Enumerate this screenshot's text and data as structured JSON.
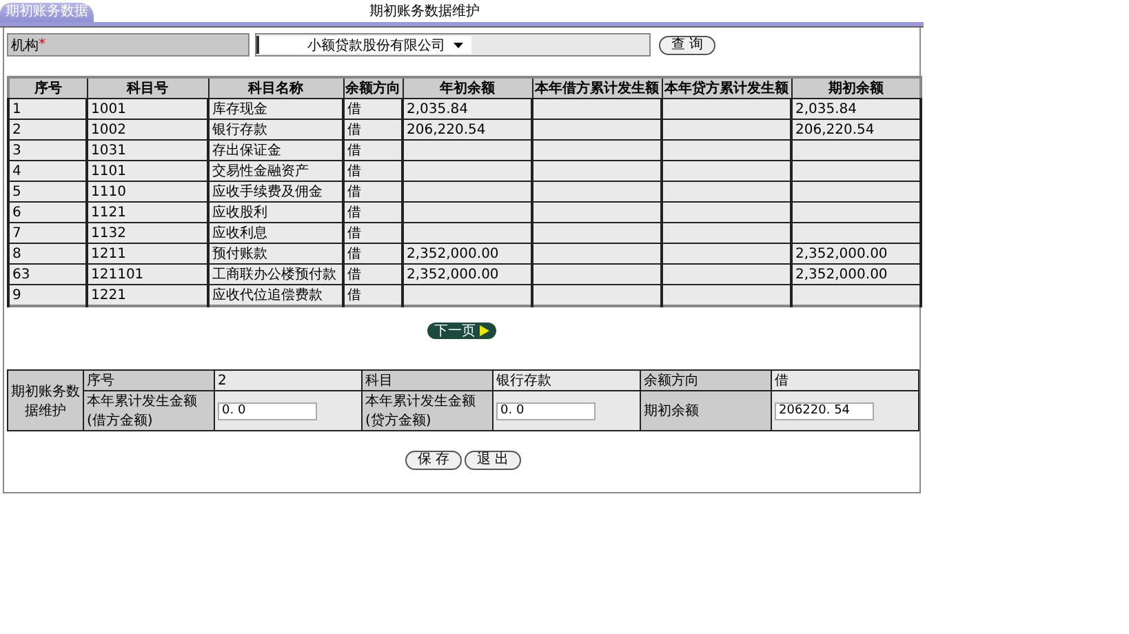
{
  "tab": {
    "label": "期初账务数据",
    "selected": true
  },
  "title": "期初账务数据维护",
  "filter": {
    "label": "机构",
    "required_mark": "*",
    "org_select": "小额贷款股份有限公司",
    "query_button": "查 询"
  },
  "table": {
    "columns": [
      "序号",
      "科目号",
      "科目名称",
      "余额方向",
      "年初余额",
      "本年借方累计发生额",
      "本年贷方累计发生额",
      "期初余额"
    ],
    "rows": [
      [
        "1",
        "1001",
        "库存现金",
        "借",
        "2,035.84",
        "",
        "",
        "2,035.84"
      ],
      [
        "2",
        "1002",
        "银行存款",
        "借",
        "206,220.54",
        "",
        "",
        "206,220.54"
      ],
      [
        "3",
        "1031",
        "存出保证金",
        "借",
        "",
        "",
        "",
        ""
      ],
      [
        "4",
        "1101",
        "交易性金融资产",
        "借",
        "",
        "",
        "",
        ""
      ],
      [
        "5",
        "1110",
        "应收手续费及佣金",
        "借",
        "",
        "",
        "",
        ""
      ],
      [
        "6",
        "1121",
        "应收股利",
        "借",
        "",
        "",
        "",
        ""
      ],
      [
        "7",
        "1132",
        "应收利息",
        "借",
        "",
        "",
        "",
        ""
      ],
      [
        "8",
        "1211",
        "预付账款",
        "借",
        "2,352,000.00",
        "",
        "",
        "2,352,000.00"
      ],
      [
        "63",
        "121101",
        "工商联办公楼预付款",
        "借",
        "2,352,000.00",
        "",
        "",
        "2,352,000.00"
      ],
      [
        "9",
        "1221",
        "应收代位追偿费款",
        "借",
        "",
        "",
        "",
        ""
      ]
    ]
  },
  "next_button": "下一页",
  "form": {
    "section_label": "期初账务数据维护",
    "rows": [
      [
        {
          "label": "序号",
          "value": "2",
          "kind": "text"
        },
        {
          "label": "科目",
          "value": "银行存款",
          "kind": "text"
        },
        {
          "label": "余额方向",
          "value": "借",
          "kind": "text"
        }
      ],
      [
        {
          "label": "本年累计发生金额(借方金额)",
          "value": "0. 0",
          "kind": "input"
        },
        {
          "label": "本年累计发生金额(贷方金额)",
          "value": "0. 0",
          "kind": "input"
        },
        {
          "label": "期初余额",
          "value": "206220. 54",
          "kind": "input"
        }
      ]
    ]
  },
  "buttons": [
    "保 存",
    "退 出"
  ]
}
